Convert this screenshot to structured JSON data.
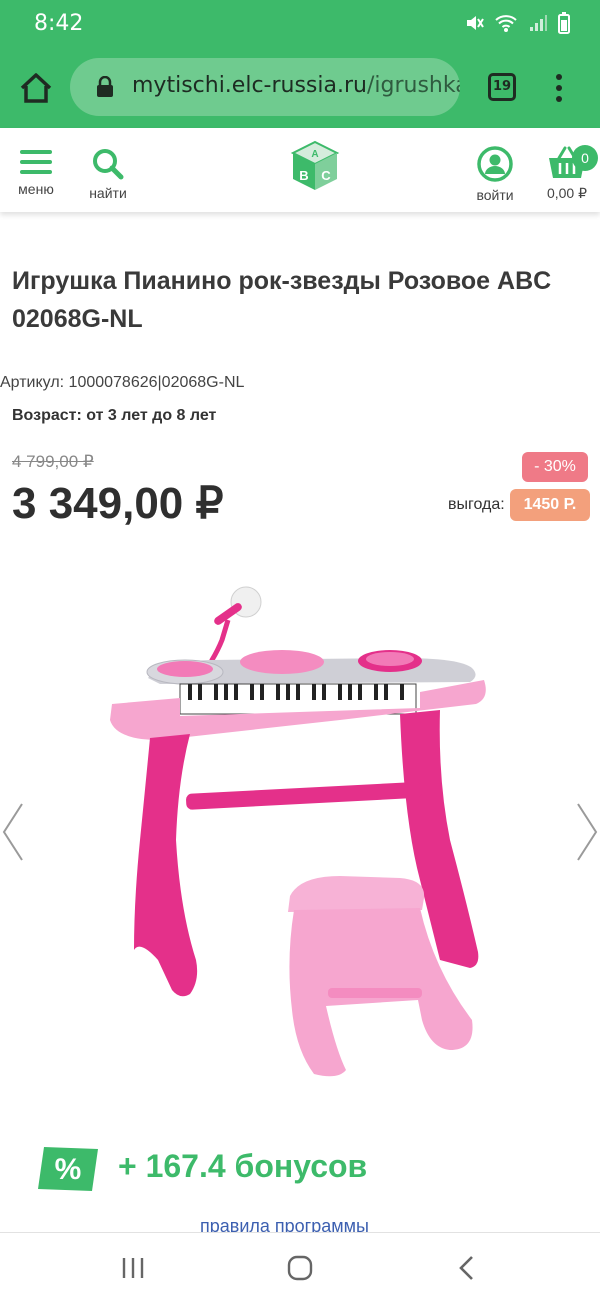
{
  "status_bar": {
    "time": "8:42"
  },
  "browser": {
    "url_domain": "mytischi.elc-russia.ru",
    "url_path": "/igrushka",
    "tab_count": "19"
  },
  "header": {
    "menu_label": "меню",
    "search_label": "найти",
    "login_label": "войти",
    "cart_total": "0,00 ₽",
    "cart_count": "0"
  },
  "product": {
    "title": "Игрушка Пианино рок-звезды Розовое ABC 02068G-NL",
    "article": "Артикул: 1000078626|02068G-NL",
    "age": "Возраст: от 3 лет до 8 лет",
    "old_price": "4 799,00 ₽",
    "price": "3 349,00 ₽",
    "discount": "- 30%",
    "benefit_label": "выгода:",
    "benefit_value": "1450 Р."
  },
  "bonus": {
    "text": "+ 167.4 бонусов",
    "rules_link": "правила программы"
  },
  "colors": {
    "brand_green": "#3dba6a",
    "discount_pink": "#ef7a87",
    "benefit_orange": "#f3a07c"
  }
}
